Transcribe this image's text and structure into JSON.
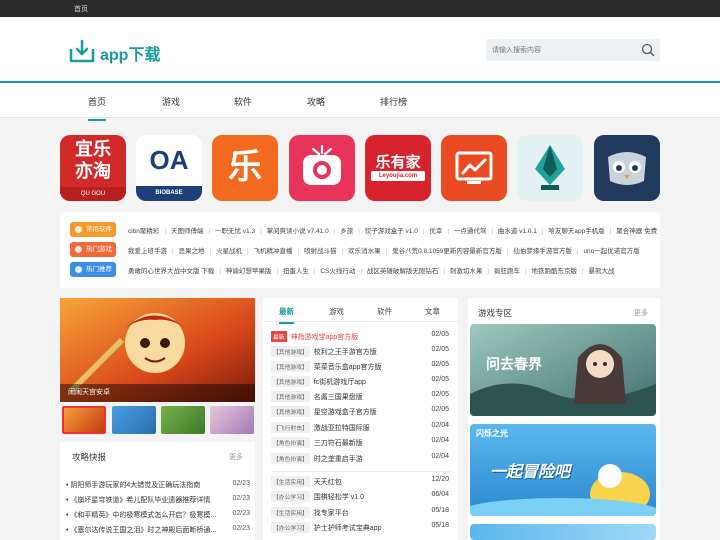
{
  "topbar": {
    "home": "首页"
  },
  "header": {
    "logo_text": "app下载",
    "search_placeholder": "请输入搜索内容"
  },
  "nav": [
    {
      "label": "首页",
      "active": true
    },
    {
      "label": "游戏"
    },
    {
      "label": "软件"
    },
    {
      "label": "攻略"
    },
    {
      "label": "排行榜"
    }
  ],
  "apps": [
    {
      "icon": "yile-yitao-icon",
      "line1": "宜乐",
      "line2": "亦淘",
      "caption": "QU  GOU",
      "color": "#d22a2a"
    },
    {
      "icon": "oa-biobase-icon",
      "line1": "OA",
      "caption": "BIOBASE",
      "color": "#1e3e7a"
    },
    {
      "icon": "le-orange-icon",
      "line1": "乐",
      "color": "#f36b21"
    },
    {
      "icon": "camera-pink-icon",
      "color": "#e8335b"
    },
    {
      "icon": "leyoujia-icon",
      "line1": "乐有家",
      "caption": "Leyoujia.com",
      "color": "#d7232e"
    },
    {
      "icon": "chart-orange-icon",
      "color": "#ea4a22"
    },
    {
      "icon": "pen-teal-icon",
      "color": "#e4f1f2"
    },
    {
      "icon": "owl-navy-icon",
      "color": "#1f3a5c"
    }
  ],
  "tags": [
    {
      "badge": "常用软件",
      "color": "#f59a2a",
      "links": [
        "cibn聚精彩",
        "天图师傅端",
        "一职无忧 v1.3",
        "掌阅爽读小说 v7.41.0",
        "乡旅",
        "饺子游戏盒子 v1.0",
        "优幸",
        "一点通代驾",
        "曲水道 v1.0.1",
        "哈友聊天app手机版",
        "聚合神器 免费"
      ]
    },
    {
      "badge": "热门游戏",
      "color": "#f06a3a",
      "links": [
        "我爱上班手游",
        "恶果之地",
        "火星战机",
        "飞机精冲直播",
        "喷射战斗猫",
        "欢乐消水果",
        "鬼谷八荒0.8.1059更新内容最新官方版",
        "仙伯梦缘手游官方版",
        "uno一起优诺官方版"
      ]
    },
    {
      "badge": "热门推荐",
      "color": "#3a8ee6",
      "links": [
        "勇敢的心世界大战中文版 下载",
        "神谕幻想苹果版",
        "扭蛋人生",
        "CS火线行动",
        "战区英雄破解版无限钻石",
        "刺激切水果",
        "疯狂跑车",
        "地铁跑酷东京版",
        "暴熊大战"
      ]
    }
  ],
  "banner": {
    "caption": "闹闹天宫安卓"
  },
  "strategy": {
    "title": "攻略快报",
    "more": "更多",
    "items": [
      {
        "title": "阴阳师手游玩家的4大错觉及正确玩法指南",
        "date": "02/23"
      },
      {
        "title": "《崩坏星穹铁道》希儿配队毕业遗器推荐详情",
        "date": "02/23"
      },
      {
        "title": "《和平精英》中的极寒模式怎么开启？极寒模...",
        "date": "02/23"
      },
      {
        "title": "《塞尔达传说王国之泪》时之神殿后面断桥通...",
        "date": "02/23"
      }
    ]
  },
  "latest": {
    "tabs": [
      "最新",
      "游戏",
      "软件",
      "文章"
    ],
    "games": [
      {
        "cat": "最新",
        "name": "神指游戏宝app官方版",
        "date": "02/05",
        "hot": true
      },
      {
        "cat": "【其他游戏】",
        "name": "校利之王手游官方版",
        "date": "02/05"
      },
      {
        "cat": "【其他游戏】",
        "name": "菜菜音乐盒app官方版",
        "date": "02/05"
      },
      {
        "cat": "【其他游戏】",
        "name": "fc街机游戏厅app",
        "date": "02/05"
      },
      {
        "cat": "【其他游戏】",
        "name": "名酱三国果盘版",
        "date": "02/05"
      },
      {
        "cat": "【其他游戏】",
        "name": "星空游戏盒子官方版",
        "date": "02/05"
      },
      {
        "cat": "【飞行射击】",
        "name": "激战亚拉特国际服",
        "date": "02/04"
      },
      {
        "cat": "【角色扮演】",
        "name": "三刀符石最新版",
        "date": "02/04"
      },
      {
        "cat": "【角色扮演】",
        "name": "时之垄重启手游",
        "date": "02/04"
      }
    ],
    "apps": [
      {
        "cat": "【生活实用】",
        "name": "天天红包",
        "date": "12/20"
      },
      {
        "cat": "【办公学习】",
        "name": "围棋轻松学 v1.0",
        "date": "06/04"
      },
      {
        "cat": "【生活实用】",
        "name": "找专家平台",
        "date": "05/18"
      },
      {
        "cat": "【办公学习】",
        "name": "护士护师考试宝典app",
        "date": "05/18"
      }
    ]
  },
  "zone": {
    "title": "游戏专区",
    "more": "更多",
    "images": [
      {
        "caption": "问去春界"
      },
      {
        "caption": "一起冒险吧",
        "sub": "闪烁之光"
      }
    ]
  }
}
